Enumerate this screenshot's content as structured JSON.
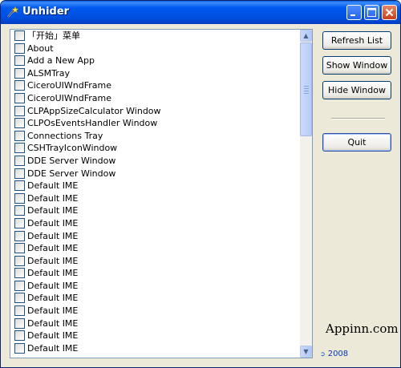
{
  "window": {
    "title": "Unhider"
  },
  "titlebar": {
    "minimize_icon": "minimize-icon",
    "maximize_icon": "maximize-icon",
    "close_icon": "close-icon"
  },
  "list": {
    "items": [
      "「开始」菜单",
      "About",
      "Add a New App",
      "ALSMTray",
      "CiceroUIWndFrame",
      "CiceroUIWndFrame",
      "CLPAppSizeCalculator Window",
      "CLPOsEventsHandler Window",
      "Connections Tray",
      "CSHTrayIconWindow",
      "DDE Server Window",
      "DDE Server Window",
      "Default IME",
      "Default IME",
      "Default IME",
      "Default IME",
      "Default IME",
      "Default IME",
      "Default IME",
      "Default IME",
      "Default IME",
      "Default IME",
      "Default IME",
      "Default IME",
      "Default IME",
      "Default IME"
    ]
  },
  "buttons": {
    "refresh": "Refresh List",
    "show": "Show Window",
    "hide": "Hide Window",
    "quit": "Quit"
  },
  "watermark": "Appinn.com",
  "footer": {
    "year": "2008"
  },
  "colors": {
    "titlebar": "#0054e3",
    "window_bg": "#ece9d8",
    "link": "#0b36b7"
  }
}
